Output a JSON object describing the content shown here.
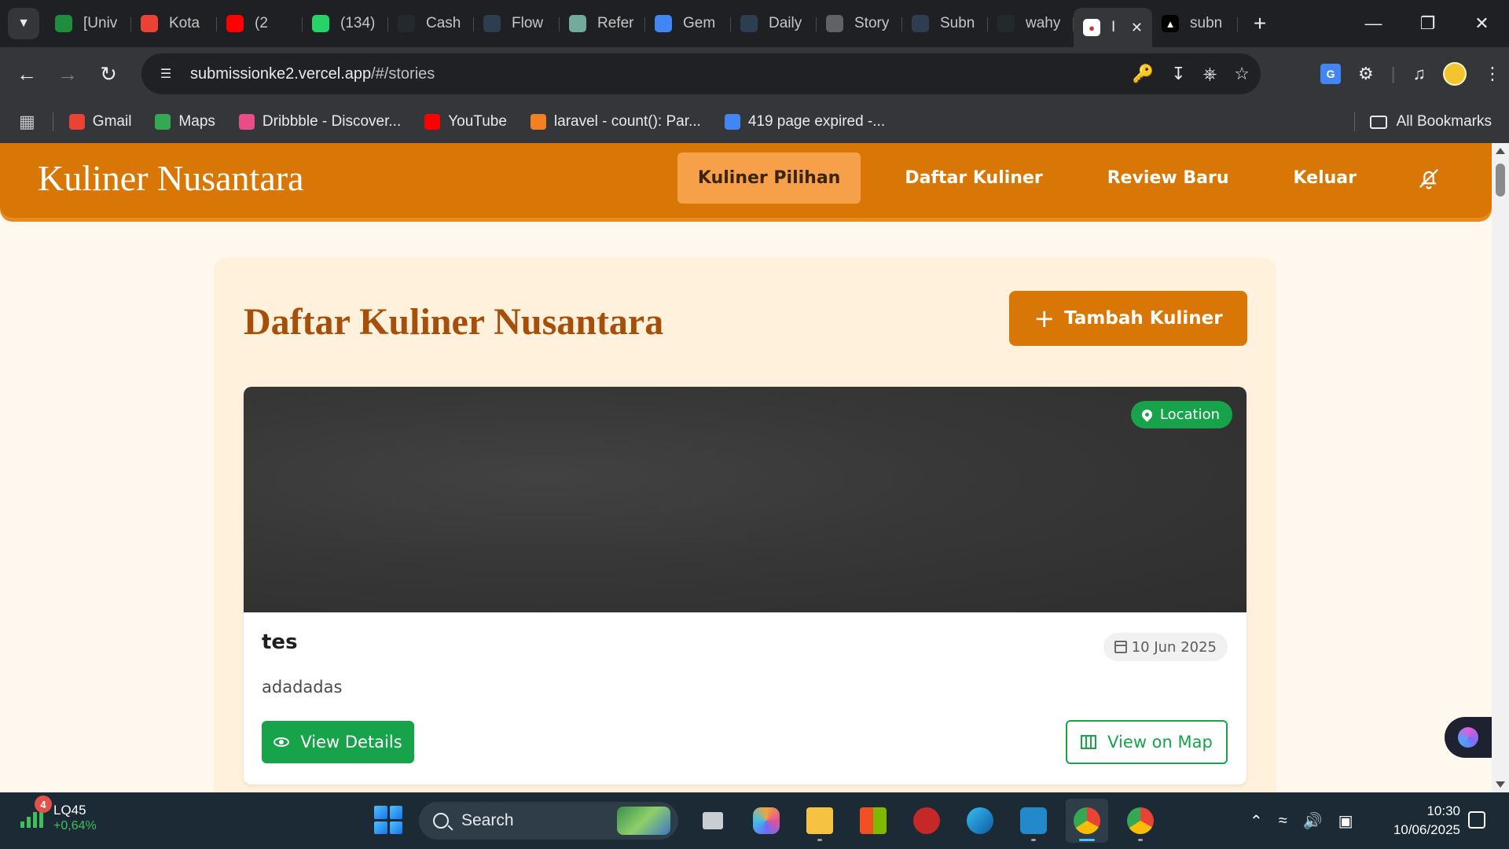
{
  "browser": {
    "tabs": [
      {
        "title": "[Univ",
        "icon": "sheets-icon",
        "color": "#1e8e3e"
      },
      {
        "title": "Kota",
        "icon": "gmail-icon",
        "color": "#ea4335"
      },
      {
        "title": "(2",
        "icon": "youtube-icon",
        "color": "#ff0000"
      },
      {
        "title": "(134)",
        "icon": "whatsapp-icon",
        "color": "#25d366"
      },
      {
        "title": "Cash",
        "icon": "github-icon",
        "color": "#24292e"
      },
      {
        "title": "Flow",
        "icon": "dicoding-icon",
        "color": "#2d3e50"
      },
      {
        "title": "Refer",
        "icon": "chatgpt-icon",
        "color": "#74aa9c"
      },
      {
        "title": "Gem",
        "icon": "gemini-icon",
        "color": "#4285f4"
      },
      {
        "title": "Daily",
        "icon": "dicoding-icon",
        "color": "#2d3e50"
      },
      {
        "title": "Story",
        "icon": "globe-icon",
        "color": "#5f6368"
      },
      {
        "title": "Subn",
        "icon": "dicoding-icon",
        "color": "#2d3e50"
      },
      {
        "title": "wahy",
        "icon": "github-icon",
        "color": "#24292e"
      }
    ],
    "active_tab": {
      "title": "I",
      "icon": "map-pin-icon"
    },
    "last_tab": {
      "title": "subn",
      "icon": "vercel-icon"
    },
    "url_host": "submissionke2.vercel.app",
    "url_path": "/#/stories",
    "bookmarks": [
      {
        "label": "Gmail",
        "icon": "gmail-icon",
        "color": "#ea4335"
      },
      {
        "label": "Maps",
        "icon": "maps-icon",
        "color": "#34a853"
      },
      {
        "label": "Dribbble - Discover...",
        "icon": "dribbble-icon",
        "color": "#ea4c89"
      },
      {
        "label": "YouTube",
        "icon": "youtube-icon",
        "color": "#ff0000"
      },
      {
        "label": "laravel - count(): Par...",
        "icon": "stackoverflow-icon",
        "color": "#f48024"
      },
      {
        "label": "419 page expired -...",
        "icon": "google-icon",
        "color": "#4285f4"
      }
    ],
    "all_bookmarks": "All Bookmarks"
  },
  "app": {
    "logo": "Kuliner Nusantara",
    "nav": [
      "Kuliner Pilihan",
      "Daftar Kuliner",
      "Review Baru",
      "Keluar"
    ],
    "active_nav": "Kuliner Pilihan",
    "page_title": "Daftar Kuliner Nusantara",
    "add_button": "Tambah Kuliner",
    "colors": {
      "primary": "#d97706",
      "success": "#16a34a",
      "background": "#fff8ee"
    }
  },
  "stories": [
    {
      "title": "tes",
      "description": "adadadas",
      "date": "10 Jun 2025",
      "location_badge": "Location",
      "details_button": "View Details",
      "map_button": "View on Map"
    }
  ],
  "taskbar": {
    "widget_label": "LQ45",
    "widget_change": "+0,64%",
    "widget_badge": "4",
    "search_placeholder": "Search",
    "time": "10:30",
    "date": "10/06/2025"
  }
}
